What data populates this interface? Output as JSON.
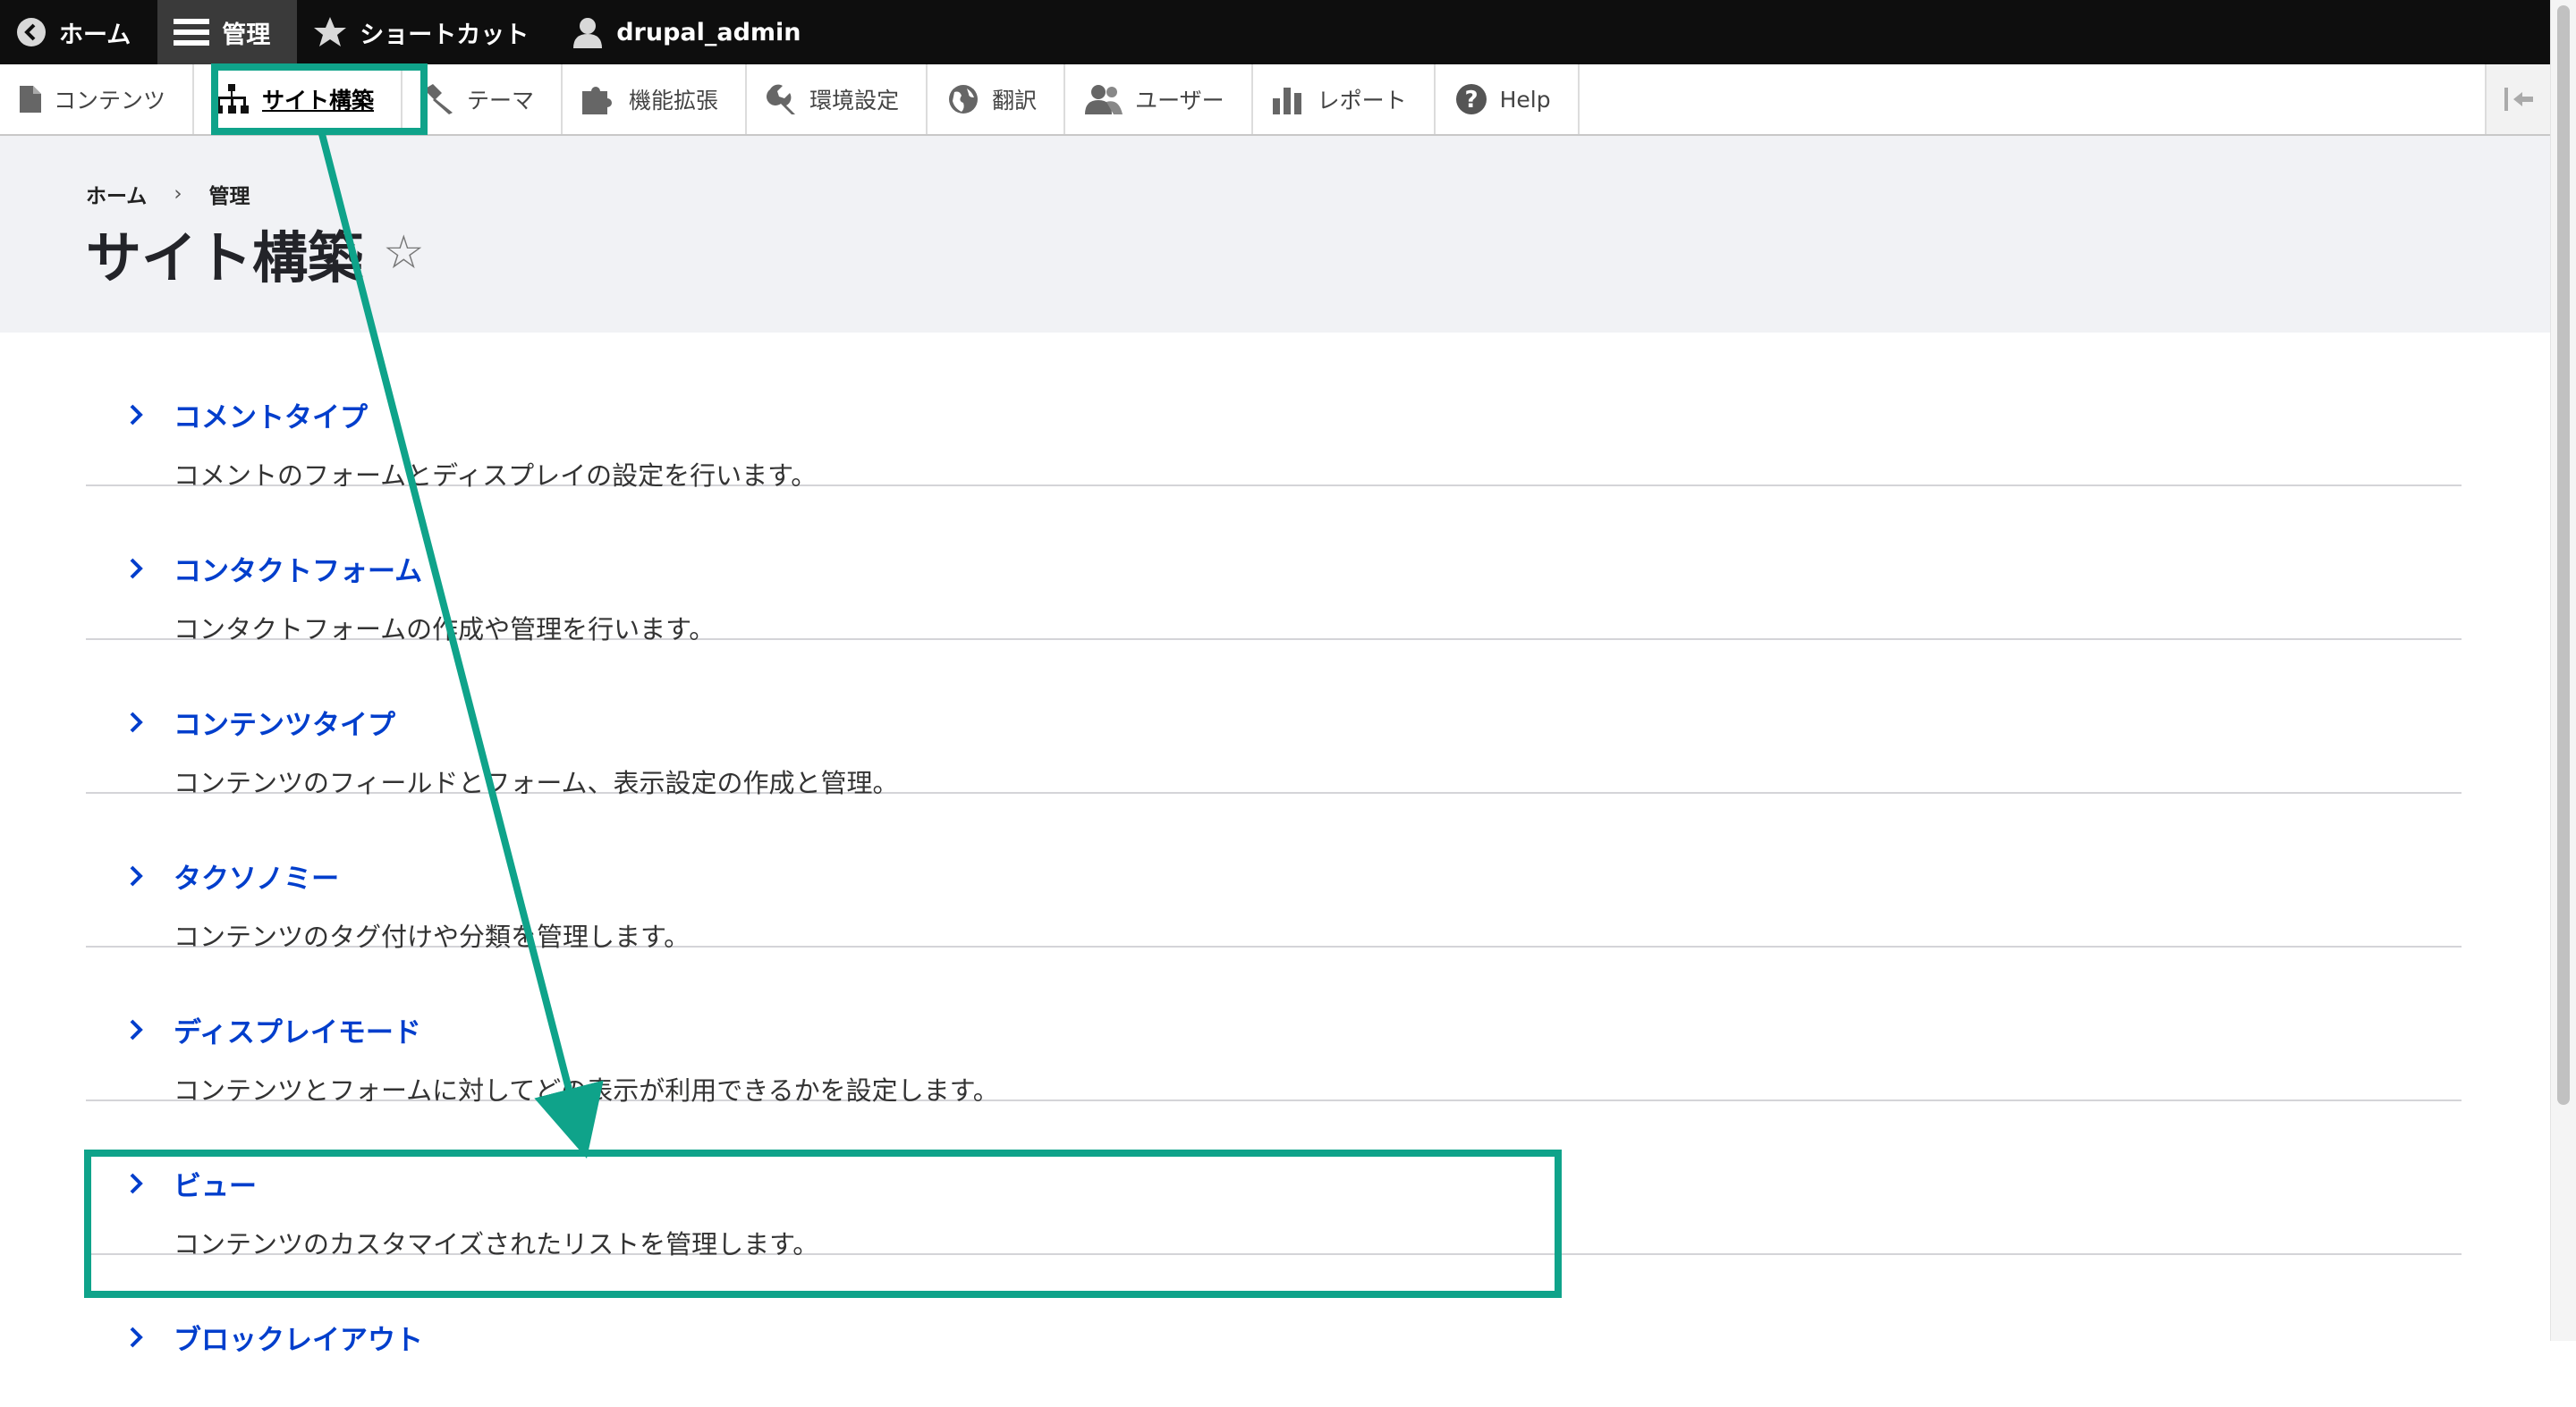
{
  "topbar": {
    "home": "ホーム",
    "manage": "管理",
    "shortcuts": "ショートカット",
    "user": "drupal_admin"
  },
  "tray": {
    "items": [
      {
        "label": "コンテンツ",
        "icon": "file-icon"
      },
      {
        "label": "サイト構築",
        "icon": "sitemap-icon",
        "active": true
      },
      {
        "label": "テーマ",
        "icon": "paintbrush-icon"
      },
      {
        "label": "機能拡張",
        "icon": "puzzle-icon"
      },
      {
        "label": "環境設定",
        "icon": "wrench-icon"
      },
      {
        "label": "翻訳",
        "icon": "globe-icon"
      },
      {
        "label": "ユーザー",
        "icon": "users-icon"
      },
      {
        "label": "レポート",
        "icon": "bar-chart-icon"
      },
      {
        "label": "Help",
        "icon": "help-icon"
      }
    ]
  },
  "breadcrumb": {
    "home": "ホーム",
    "separator": "›",
    "manage": "管理"
  },
  "page": {
    "title": "サイト構築",
    "favorite": "☆"
  },
  "admin_list": [
    {
      "title": "コメントタイプ",
      "description": "コメントのフォームとディスプレイの設定を行います。"
    },
    {
      "title": "コンタクトフォーム",
      "description": "コンタクトフォームの作成や管理を行います。"
    },
    {
      "title": "コンテンツタイプ",
      "description": "コンテンツのフィールドとフォーム、表示設定の作成と管理。"
    },
    {
      "title": "タクソノミー",
      "description": "コンテンツのタグ付けや分類を管理します。"
    },
    {
      "title": "ディスプレイモード",
      "description": "コンテンツとフォームに対してどの表示が利用できるかを設定します。"
    },
    {
      "title": "ビュー",
      "description": "コンテンツのカスタマイズされたリストを管理します。"
    },
    {
      "title": "ブロックレイアウト",
      "description": ""
    }
  ],
  "colors": {
    "link": "#003ecc",
    "highlight": "#0fa38a",
    "topbar": "#0e0e0e",
    "header_bg": "#f1f2f5"
  }
}
